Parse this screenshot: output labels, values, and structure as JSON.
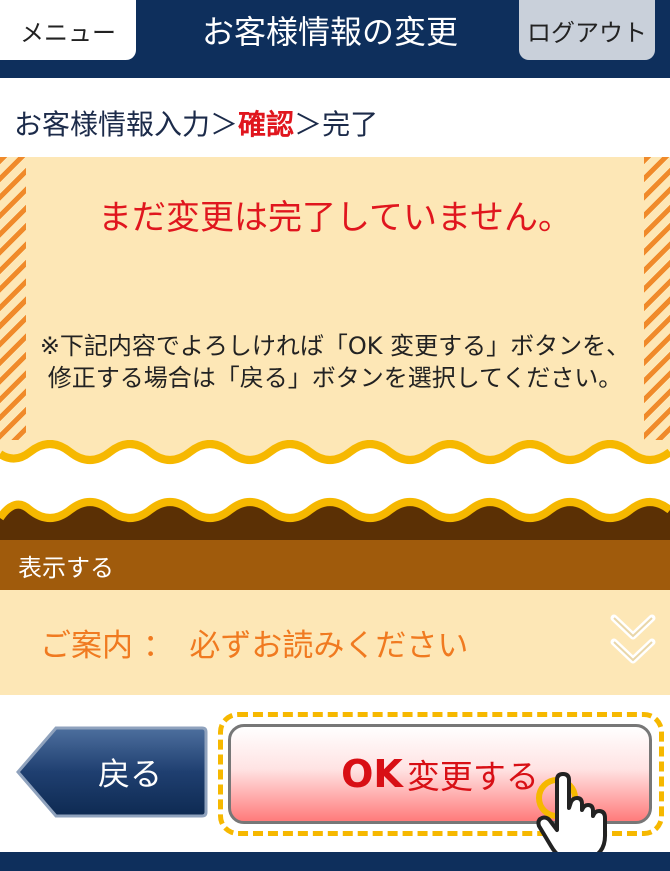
{
  "header": {
    "menu_label": "メニュー",
    "title": "お客様情報の変更",
    "logout_label": "ログアウト"
  },
  "breadcrumb": {
    "step1": "お客様情報入力",
    "sep1": "＞",
    "current": "確認",
    "sep2": "＞",
    "step3": "完了"
  },
  "notice": {
    "title": "まだ変更は完了していません。",
    "body": "※下記内容でよろしければ「OK 変更する」ボタンを、修正する場合は「戻る」ボタンを選択してください。"
  },
  "section": {
    "bar_label": "表示する",
    "guide_text": "ご案内 ：　必ずお読みください"
  },
  "buttons": {
    "back_label": "戻る",
    "ok_strong": "OK",
    "ok_rest": "変更する"
  },
  "colors": {
    "navy": "#0e2f5c",
    "red": "#e0161e",
    "cream": "#fde7b6",
    "brown": "#a05b0c",
    "orange": "#f07a20",
    "gold": "#f6b800"
  },
  "icons": {
    "guide_expand": "double-chevron-down-icon",
    "pointer": "pointing-hand-icon"
  }
}
